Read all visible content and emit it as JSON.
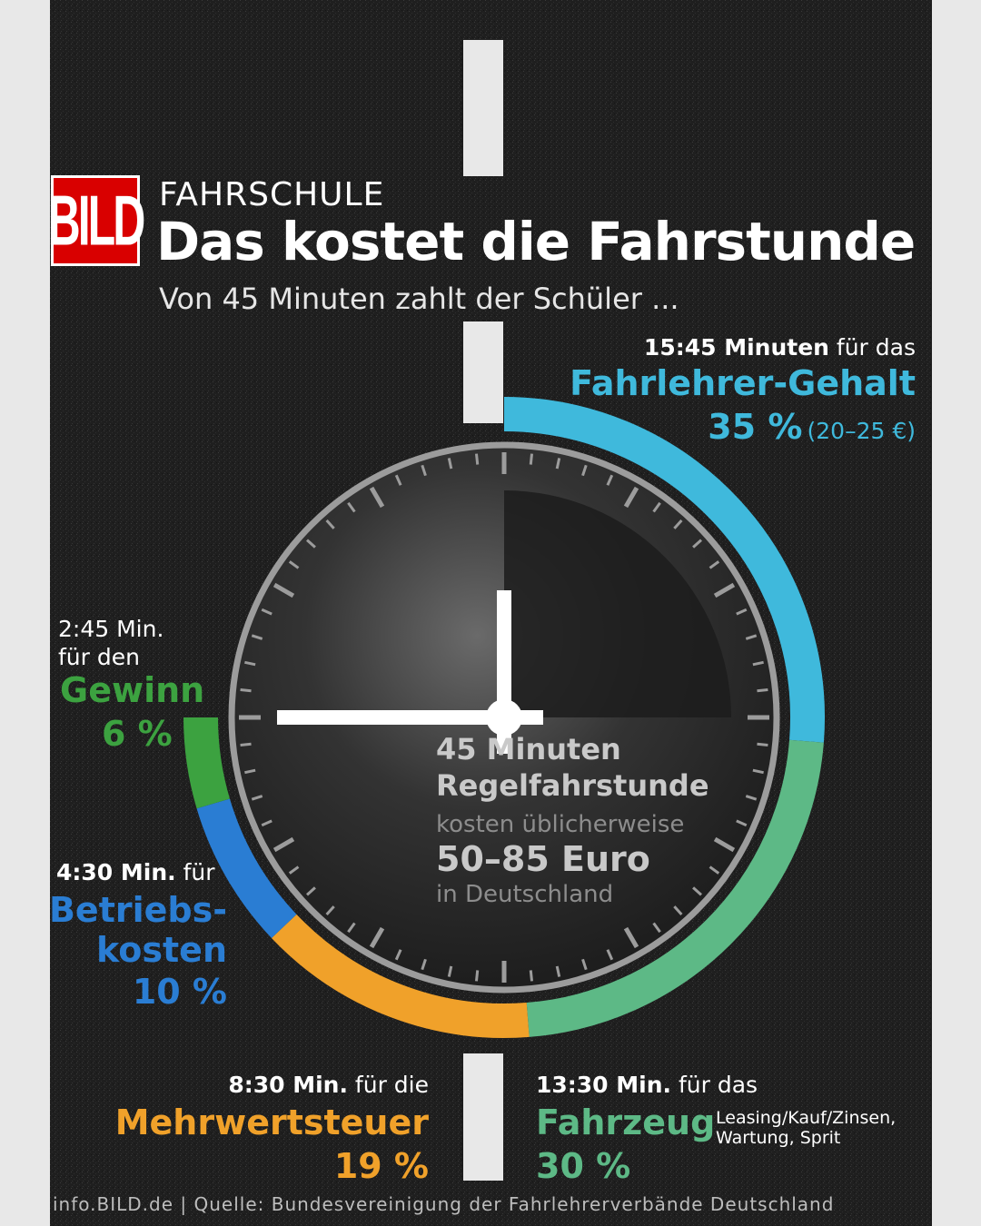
{
  "header": {
    "logo": "BILD",
    "kicker": "FAHRSCHULE",
    "headline": "Das kostet die Fahrstunde",
    "intro": "Von 45 Minuten zahlt der Schüler ..."
  },
  "center": {
    "line1": "45 Minuten",
    "line2": "Regelfahrstunde",
    "line3": "kosten üblicherweise",
    "line4": "50–85 Euro",
    "line5": "in Deutschland"
  },
  "labels": {
    "gehalt": {
      "time": "15:45 Minuten",
      "suffix": "für das",
      "name": "Fahrlehrer-Gehalt",
      "pct": "35 %",
      "note": "(20–25 €)"
    },
    "fahrzeug": {
      "time": "13:30 Min.",
      "suffix": "für das",
      "name": "Fahrzeug",
      "pct": "30 %",
      "note1": "Leasing/Kauf/Zinsen,",
      "note2": "Wartung, Sprit"
    },
    "steuer": {
      "time": "8:30 Min.",
      "suffix": "für die",
      "name": "Mehrwertsteuer",
      "pct": "19 %"
    },
    "betrieb": {
      "time": "4:30 Min.",
      "suffix": "für",
      "name1": "Betriebs-",
      "name2": "kosten",
      "pct": "10 %"
    },
    "gewinn": {
      "time": "2:45 Min.",
      "suffix": "für den",
      "name": "Gewinn",
      "pct": "6 %"
    }
  },
  "source": "info.BILD.de | Quelle: Bundesvereinigung der Fahrlehrerverbände Deutschland",
  "chart_data": {
    "type": "pie",
    "total_minutes": 45,
    "series": [
      {
        "name": "Fahrlehrer-Gehalt",
        "minutes": 15.75,
        "percent": 35,
        "color": "#3fb9dc"
      },
      {
        "name": "Fahrzeug",
        "minutes": 13.5,
        "percent": 30,
        "color": "#5db986"
      },
      {
        "name": "Mehrwertsteuer",
        "minutes": 8.5,
        "percent": 19,
        "color": "#f0a12a"
      },
      {
        "name": "Betriebskosten",
        "minutes": 4.5,
        "percent": 10,
        "color": "#2a7dd3"
      },
      {
        "name": "Gewinn",
        "minutes": 2.75,
        "percent": 6,
        "color": "#3ca240"
      }
    ]
  },
  "colors": {
    "asphalt": "#1e1e1e",
    "road_marking": "#f2f2f2",
    "brand_red": "#d90000"
  }
}
